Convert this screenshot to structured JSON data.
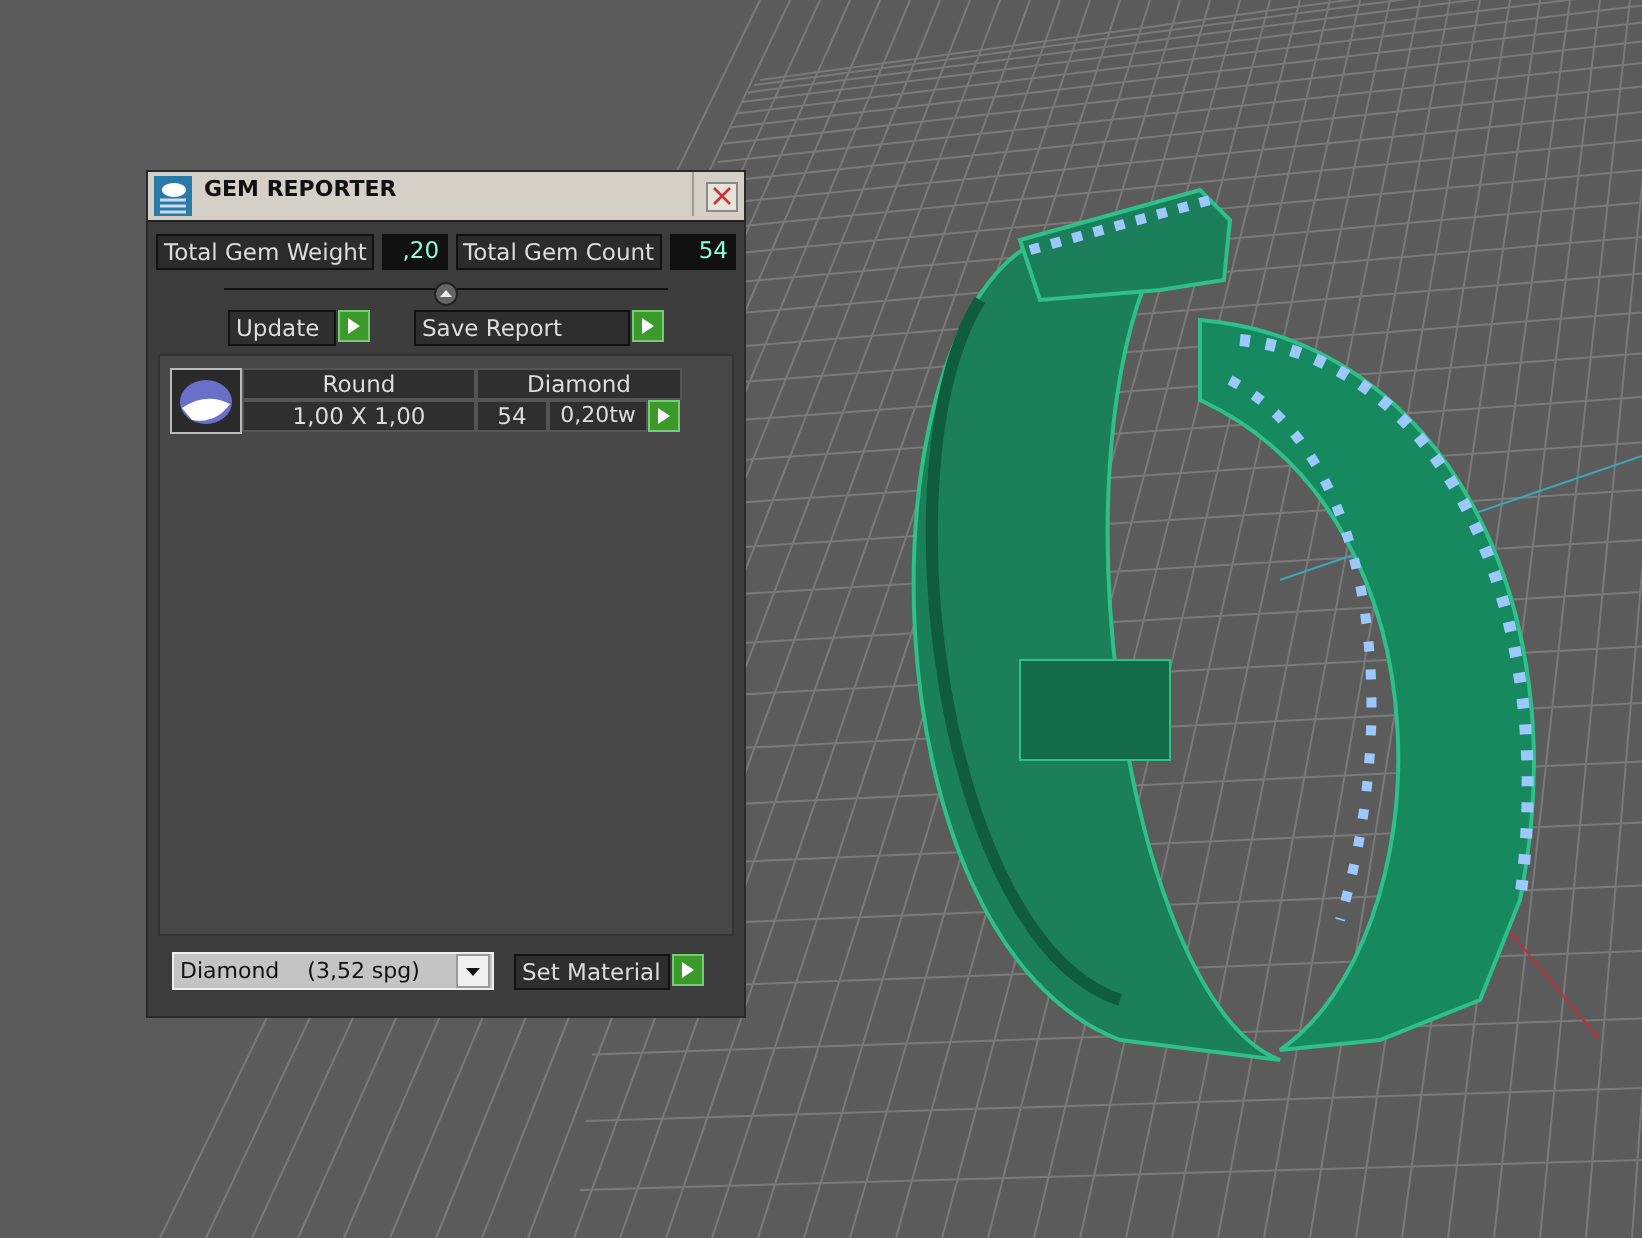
{
  "panel": {
    "title": "GEM REPORTER",
    "totals": [
      {
        "label": "Total Gem Weight",
        "value": ",20"
      },
      {
        "label": "Total Gem Count",
        "value": "54"
      }
    ],
    "buttons": [
      {
        "label": "Update"
      },
      {
        "label": "Save Report"
      }
    ],
    "gems": [
      {
        "shape": "Round",
        "material": "Diamond",
        "size": "1,00 X 1,00",
        "count": "54",
        "weight": "0,20tw"
      }
    ],
    "material_select": {
      "value": "Diamond    (3,52 spg)"
    },
    "set_button": {
      "label": "Set Material"
    }
  }
}
